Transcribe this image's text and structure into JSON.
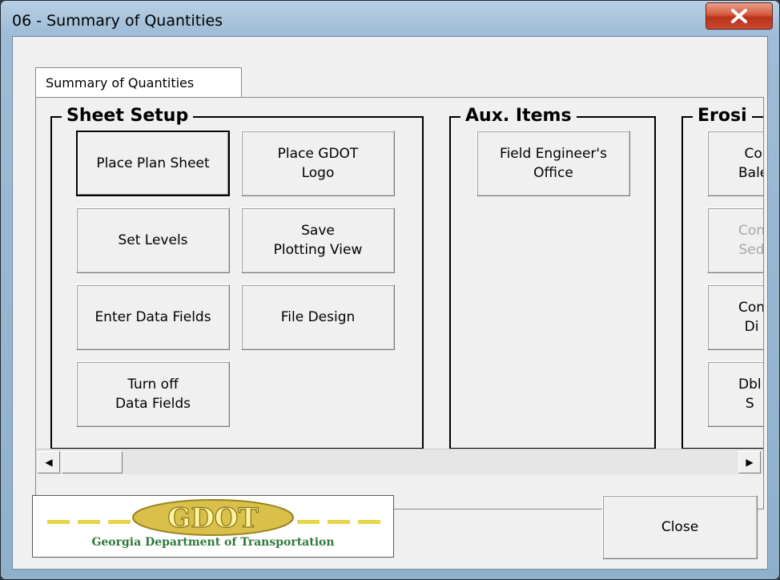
{
  "window": {
    "title": "06 - Summary of Quantities",
    "close_glyph": "X"
  },
  "tabs": [
    {
      "label": "Summary of Quantities"
    }
  ],
  "frames": {
    "sheet_setup": {
      "title": "Sheet Setup",
      "buttons": {
        "place_plan_sheet": "Place Plan Sheet",
        "place_gdot_logo": "Place GDOT\nLogo",
        "set_levels": "Set Levels",
        "save_plotting_view": "Save\nPlotting View",
        "enter_data_fields": "Enter Data Fields",
        "file_design": "File Design",
        "turn_off_data_fields": "Turn off\nData Fields"
      }
    },
    "aux_items": {
      "title": "Aux. Items",
      "buttons": {
        "field_engineers_office": "Field Engineer's\nOffice"
      }
    },
    "erosion": {
      "title": "Erosi",
      "buttons": {
        "b1": "Co\nBale",
        "b2": "Con\nSed",
        "b3": "Con\nDi",
        "b4": "Dbl\nS"
      }
    }
  },
  "logo": {
    "caption": "Georgia Department of Transportation",
    "mark": "GDOT"
  },
  "footer": {
    "close_label": "Close"
  },
  "scrollbar": {
    "left_arrow": "◀",
    "right_arrow": "▶"
  },
  "colors": {
    "close_red": "#c8482c",
    "logo_gold": "#d8c04a",
    "logo_green": "#2e7a3a"
  }
}
